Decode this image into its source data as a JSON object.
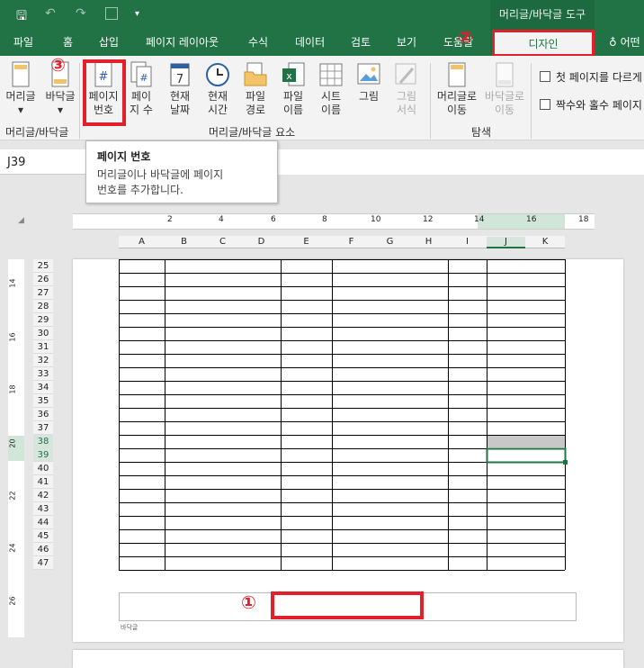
{
  "qat": {
    "save": "🖫",
    "undo": "↶",
    "redo": "↷",
    "more": "▾"
  },
  "context_title": "머리글/바닥글 도구",
  "tabs": [
    "파일",
    "홈",
    "삽입",
    "페이지 레이아웃",
    "수식",
    "데이터",
    "검토",
    "보기",
    "도움말"
  ],
  "design_tab": "디자인",
  "tell_me": "어떤",
  "ribbon": {
    "header": {
      "l1": "머리글"
    },
    "footer": {
      "l1": "바닥글"
    },
    "page_number": {
      "l1": "페이지",
      "l2": "번호",
      "glyph": "#"
    },
    "page_count": {
      "l1": "페이",
      "l2": "지 수",
      "glyph": "#"
    },
    "current_date": {
      "l1": "현재",
      "l2": "날짜",
      "glyph": "7"
    },
    "current_time": {
      "l1": "현재",
      "l2": "시간"
    },
    "file_path": {
      "l1": "파일",
      "l2": "경로"
    },
    "file_name": {
      "l1": "파일",
      "l2": "이름"
    },
    "sheet_name": {
      "l1": "시트",
      "l2": "이름"
    },
    "picture": {
      "l1": "그림"
    },
    "format_picture": {
      "l1": "그림",
      "l2": "서식"
    },
    "goto_header": {
      "l1": "머리글로",
      "l2": "이동"
    },
    "goto_footer": {
      "l1": "바닥글로",
      "l2": "이동"
    },
    "group_hf": "머리글/바닥글",
    "group_elements": "머리글/바닥글 요소",
    "group_nav": "탐색",
    "option_first": "첫 페이지를 다르게",
    "option_oddeven": "짝수와 홀수 페이지"
  },
  "tooltip": {
    "title": "페이지 번호",
    "line1": "머리글이나 바닥글에 페이지",
    "line2": "번호를 추가합니다."
  },
  "namebox": "J39",
  "ruler_h": [
    "2",
    "4",
    "6",
    "8",
    "10",
    "12",
    "14",
    "16",
    "18"
  ],
  "columns": [
    "A",
    "B",
    "C",
    "D",
    "E",
    "F",
    "G",
    "H",
    "I",
    "J",
    "K"
  ],
  "rows": [
    "25",
    "26",
    "27",
    "28",
    "29",
    "30",
    "31",
    "32",
    "33",
    "34",
    "35",
    "36",
    "37",
    "38",
    "39",
    "40",
    "41",
    "42",
    "43",
    "44",
    "45",
    "46",
    "47"
  ],
  "ruler_v": [
    "14",
    "16",
    "18",
    "20",
    "22",
    "24",
    "26"
  ],
  "footer_label": "바닥글",
  "markers": {
    "m1": "①",
    "m2": "②",
    "m3": "③"
  },
  "colors": {
    "excel_green": "#217346",
    "highlight_red": "#e2202b",
    "selected_fill": "#c8c8c8"
  }
}
